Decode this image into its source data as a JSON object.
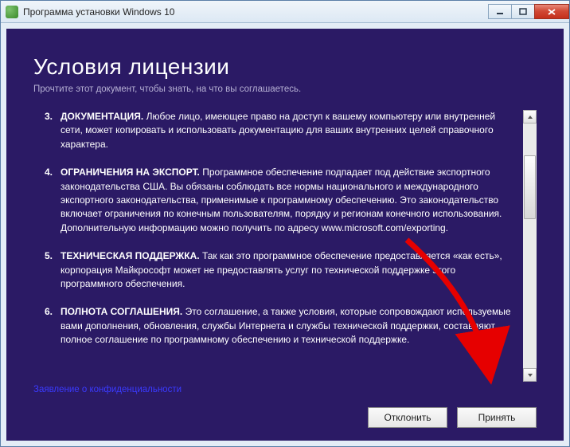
{
  "titlebar": {
    "title": "Программа установки Windows 10"
  },
  "installer": {
    "heading": "Условия лицензии",
    "subtitle": "Прочтите этот документ, чтобы знать, на что вы соглашаетесь.",
    "items": [
      {
        "num": "3.",
        "title": "ДОКУМЕНТАЦИЯ.",
        "text": " Любое лицо, имеющее право на доступ к вашему компьютеру или внутренней сети, может копировать и использовать документацию для ваших внутренних целей справочного характера."
      },
      {
        "num": "4.",
        "title": "ОГРАНИЧЕНИЯ НА ЭКСПОРТ.",
        "text": " Программное обеспечение подпадает под действие экспортного законодательства США. Вы обязаны соблюдать все нормы национального и международного экспортного законодательства, применимые к программному обеспечению. Это законодательство включает ограничения по конечным пользователям, порядку и регионам конечного использования. Дополнительную информацию можно получить по адресу www.microsoft.com/exporting."
      },
      {
        "num": "5.",
        "title": "ТЕХНИЧЕСКАЯ ПОДДЕРЖКА.",
        "text": " Так как это программное обеспечение предоставляется «как есть», корпорация Майкрософт может не предоставлять услуг по технической поддержке этого программного обеспечения."
      },
      {
        "num": "6.",
        "title": "ПОЛНОТА СОГЛАШЕНИЯ.",
        "text": " Это соглашение, а также условия, которые сопровождают используемые вами дополнения, обновления, службы Интернета и службы технической поддержки, составляют полное соглашение по программному обеспечению и технической поддержке."
      }
    ],
    "privacy_link": "Заявление о конфиденциальности",
    "buttons": {
      "decline": "Отклонить",
      "accept": "Принять"
    }
  }
}
